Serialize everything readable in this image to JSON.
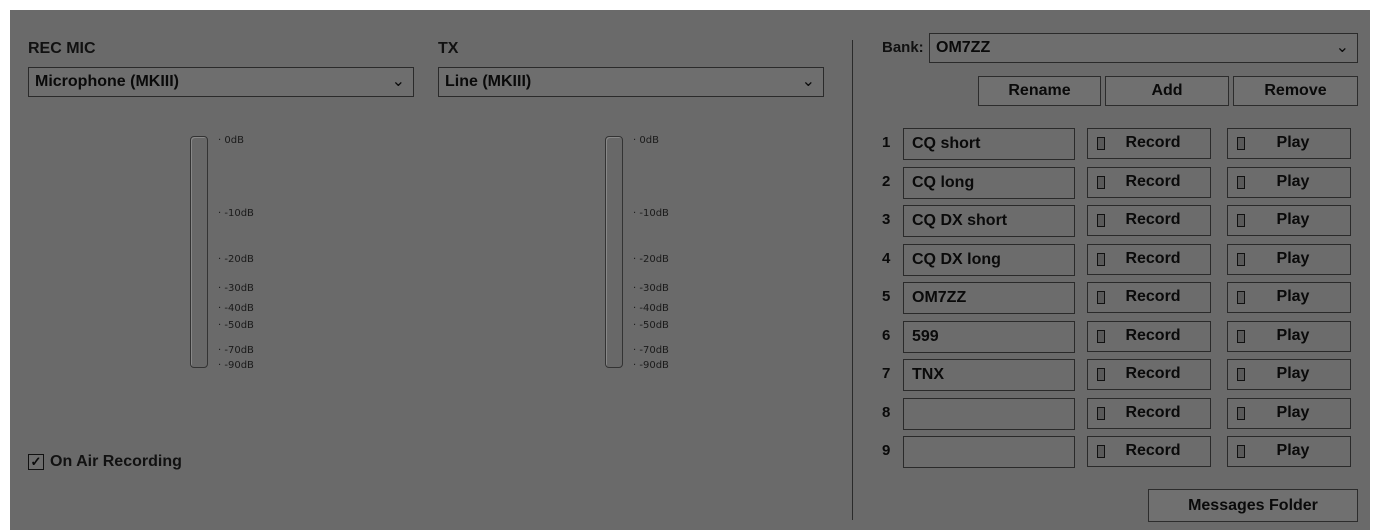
{
  "rec_mic": {
    "label": "REC MIC",
    "selected": "Microphone (MKIII)"
  },
  "tx": {
    "label": "TX",
    "selected": "Line (MKIII)"
  },
  "meter_scale": [
    "0dB",
    "-10dB",
    "-20dB",
    "-30dB",
    "-40dB",
    "-50dB",
    "-70dB",
    "-90dB"
  ],
  "on_air": {
    "label": "On Air Recording",
    "checked": true
  },
  "bank": {
    "label": "Bank:",
    "selected": "OM7ZZ"
  },
  "bank_buttons": {
    "rename": "Rename",
    "add": "Add",
    "remove": "Remove"
  },
  "messages": [
    {
      "index": "1",
      "text": "CQ short",
      "record": "Record",
      "play": "Play"
    },
    {
      "index": "2",
      "text": "CQ long",
      "record": "Record",
      "play": "Play"
    },
    {
      "index": "3",
      "text": "CQ DX short",
      "record": "Record",
      "play": "Play"
    },
    {
      "index": "4",
      "text": "CQ DX long",
      "record": "Record",
      "play": "Play"
    },
    {
      "index": "5",
      "text": "OM7ZZ",
      "record": "Record",
      "play": "Play"
    },
    {
      "index": "6",
      "text": "599",
      "record": "Record",
      "play": "Play"
    },
    {
      "index": "7",
      "text": "TNX",
      "record": "Record",
      "play": "Play"
    },
    {
      "index": "8",
      "text": "",
      "record": "Record",
      "play": "Play"
    },
    {
      "index": "9",
      "text": "",
      "record": "Record",
      "play": "Play"
    }
  ],
  "messages_folder": "Messages Folder",
  "icons": {
    "dropdown": "chevron-down-icon",
    "checkbox": "checkmark-icon",
    "led": "led-indicator-icon"
  }
}
